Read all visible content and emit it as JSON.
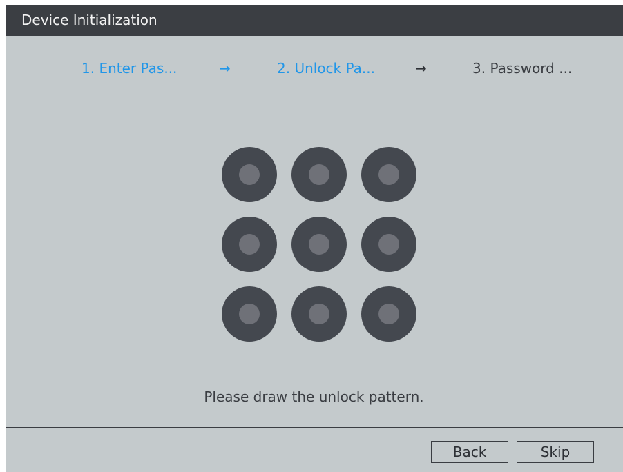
{
  "window": {
    "title": "Device Initialization"
  },
  "steps": [
    {
      "number": "1.",
      "label": "Enter Pas...",
      "state": "done"
    },
    {
      "number": "2.",
      "label": "Unlock Pa...",
      "state": "current"
    },
    {
      "number": "3.",
      "label": "Password ...",
      "state": "pending"
    }
  ],
  "arrows": [
    "→",
    "→"
  ],
  "pattern": {
    "rows": 3,
    "cols": 3
  },
  "hint": "Please draw the unlock pattern.",
  "buttons": {
    "back": "Back",
    "skip": "Skip"
  },
  "colors": {
    "accent": "#2196e8",
    "titlebar": "#3b3e43",
    "background": "#c4cacc",
    "dot": "#44484f",
    "dot_inner": "#6f7178"
  }
}
